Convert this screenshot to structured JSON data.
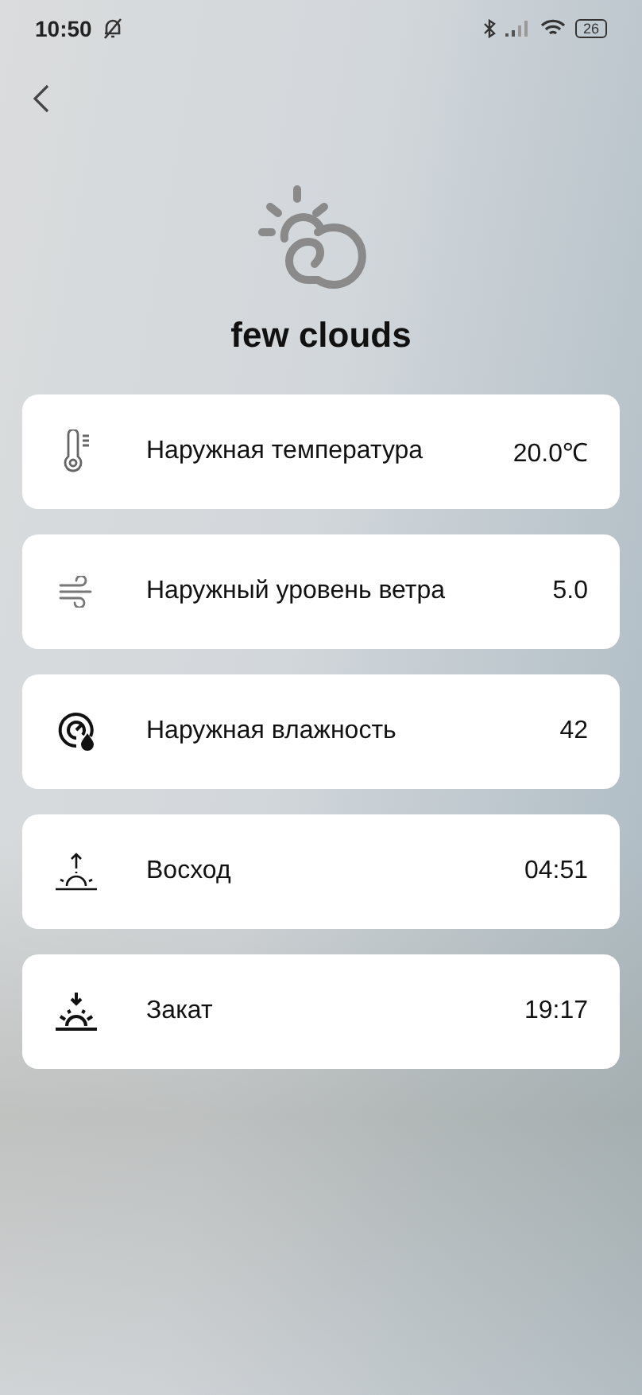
{
  "status_bar": {
    "time": "10:50",
    "battery": "26"
  },
  "weather": {
    "description": "few clouds"
  },
  "rows": [
    {
      "kind": "temperature",
      "label": "Наружная температура",
      "value": "20.0℃"
    },
    {
      "kind": "wind",
      "label": "Наружный уровень ветра",
      "value": "5.0"
    },
    {
      "kind": "humidity",
      "label": "Наружная влажность",
      "value": "42"
    },
    {
      "kind": "sunrise",
      "label": "Восход",
      "value": "04:51"
    },
    {
      "kind": "sunset",
      "label": "Закат",
      "value": "19:17"
    }
  ]
}
